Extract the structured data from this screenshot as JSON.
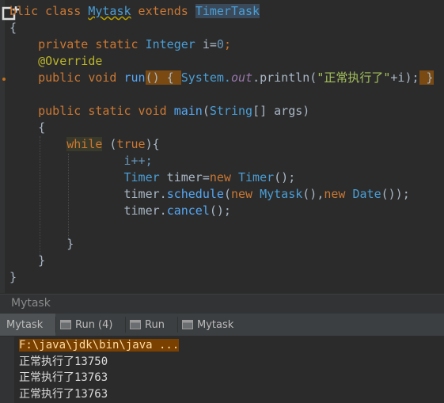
{
  "editor": {
    "lines": {
      "l1_a": "blic class ",
      "l1_b": "Mytask",
      "l1_c": " extends ",
      "l1_d": "TimerTask",
      "l2": "{",
      "l3_a": "    private static ",
      "l3_b": "Integer",
      "l3_c": " i=",
      "l3_d": "0",
      "l3_e": ";",
      "l4": "    @Override",
      "l5_a": "    public void ",
      "l5_b": "run",
      "l5_c": "()",
      "l5_d": " { ",
      "l5_e": "System.",
      "l5_f": "out",
      "l5_g": ".println(",
      "l5_h": "\"正常执行了\"",
      "l5_i": "+i);",
      "l5_j": " }",
      "l7_a": "    public static void ",
      "l7_b": "main",
      "l7_c": "(",
      "l7_d": "String",
      "l7_e": "[] args)",
      "l8": "    {",
      "l9_a": "while",
      "l9_b": " (",
      "l9_c": "true",
      "l9_d": "){",
      "l10": "i++;",
      "l11_a": "Timer",
      "l11_b": " timer=",
      "l11_c": "new ",
      "l11_d": "Timer",
      "l11_e": "();",
      "l12_a": "timer.",
      "l12_b": "schedule",
      "l12_c": "(",
      "l12_d": "new ",
      "l12_e": "Mytask",
      "l12_f": "(),",
      "l12_g": "new ",
      "l12_h": "Date",
      "l12_i": "());",
      "l13_a": "timer.",
      "l13_b": "cancel",
      "l13_c": "();",
      "l15": "}",
      "l16": "    }",
      "l17": "}"
    }
  },
  "panel": {
    "title": "Mytask"
  },
  "tabs": [
    {
      "label": "Mytask"
    },
    {
      "label": "Run (4)"
    },
    {
      "label": "Run"
    },
    {
      "label": "Mytask"
    }
  ],
  "console": {
    "command": "F:\\java\\jdk\\bin\\java ...",
    "out1": "正常执行了13750",
    "out2": "正常执行了13763",
    "out3": "正常执行了13763"
  },
  "colors": {
    "editor_bg": "#2b2b2b",
    "keyword": "#cc7832",
    "class": "#4a9ed6",
    "string": "#a5c25c"
  }
}
